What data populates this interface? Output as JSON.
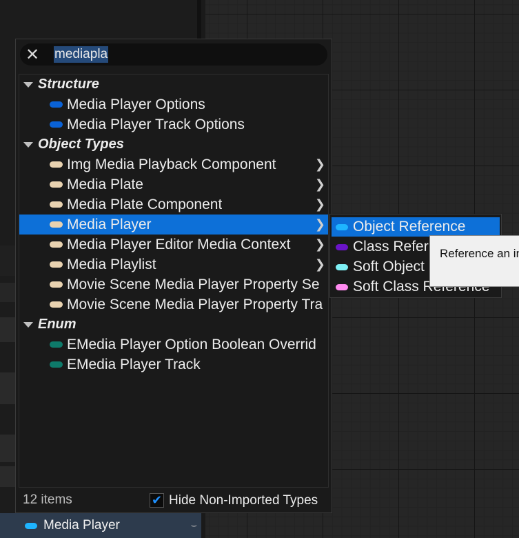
{
  "search": {
    "value": "mediapla"
  },
  "categories": [
    {
      "label": "Structure",
      "items": [
        {
          "label": "Media Player Options",
          "color": "#0a62d6",
          "submenu": false
        },
        {
          "label": "Media Player Track Options",
          "color": "#0a62d6",
          "submenu": false
        }
      ]
    },
    {
      "label": "Object Types",
      "items": [
        {
          "label": "Img Media Playback Component",
          "color": "#e8d2b0",
          "submenu": true
        },
        {
          "label": "Media Plate",
          "color": "#e8d2b0",
          "submenu": true
        },
        {
          "label": "Media Plate Component",
          "color": "#e8d2b0",
          "submenu": true
        },
        {
          "label": "Media Player",
          "color": "#e8d2b0",
          "submenu": true,
          "selected": true
        },
        {
          "label": "Media Player Editor Media Context",
          "color": "#e8d2b0",
          "submenu": true
        },
        {
          "label": "Media Playlist",
          "color": "#e8d2b0",
          "submenu": true
        },
        {
          "label": "Movie Scene Media Player Property Se",
          "color": "#e8d2b0",
          "submenu": false
        },
        {
          "label": "Movie Scene Media Player Property Tra",
          "color": "#e8d2b0",
          "submenu": false
        }
      ]
    },
    {
      "label": "Enum",
      "items": [
        {
          "label": "EMedia Player Option Boolean Overrid",
          "color": "#0e7a6a",
          "submenu": false
        },
        {
          "label": "EMedia Player Track",
          "color": "#0e7a6a",
          "submenu": false
        }
      ]
    }
  ],
  "footer": {
    "count": "12 items",
    "hide_label": "Hide Non-Imported Types",
    "checked": true
  },
  "submenu": [
    {
      "label": "Object Reference",
      "color": "#1eb4ff",
      "selected": true
    },
    {
      "label": "Class Refer",
      "color": "#6a14c8"
    },
    {
      "label": "Soft Object",
      "color": "#7ef0f5"
    },
    {
      "label": "Soft Class Reference",
      "color": "#ff8af0"
    }
  ],
  "tooltip": {
    "text": "Reference an in"
  },
  "variable_row": {
    "label": "Media Player",
    "color": "#1eb4ff"
  }
}
